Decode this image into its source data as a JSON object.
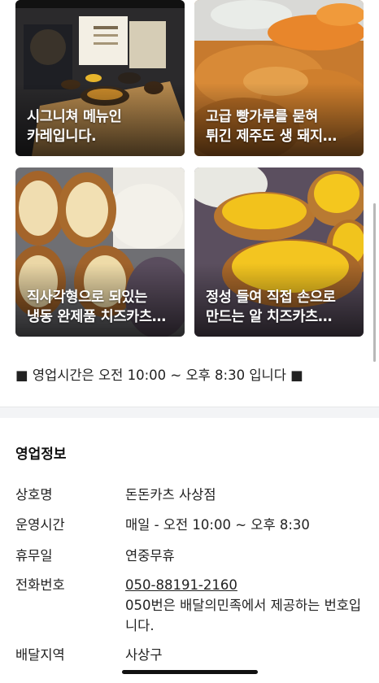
{
  "cards": [
    {
      "line1": "시그니쳐 메뉴인",
      "line2": "카레입니다."
    },
    {
      "line1": "고급 빵가루를 묻혀",
      "line2": "튀긴 제주도 생 돼지…"
    },
    {
      "line1": "직사각형으로 되있는",
      "line2": "냉동 완제품 치즈카츠…"
    },
    {
      "line1": "정성 들여 직접 손으로",
      "line2": "만드는 알 치즈카츠…"
    }
  ],
  "hours_note": "■ 영업시간은 오전 10:00 ~ 오후 8:30 입니다 ■",
  "info": {
    "title": "영업정보",
    "rows": [
      {
        "label": "상호명",
        "value": "돈돈카츠 사상점"
      },
      {
        "label": "운영시간",
        "value": "매일 - 오전 10:00 ~ 오후 8:30"
      },
      {
        "label": "휴무일",
        "value": "연중무휴"
      },
      {
        "label": "전화번호",
        "value": "050-88191-2160",
        "note": "050번은 배달의민족에서 제공하는 번호입니다."
      },
      {
        "label": "배달지역",
        "value": "사상구"
      }
    ]
  },
  "colors": {
    "divider": "#f3f4f6",
    "text": "#222222",
    "caption": "#ffffff"
  }
}
